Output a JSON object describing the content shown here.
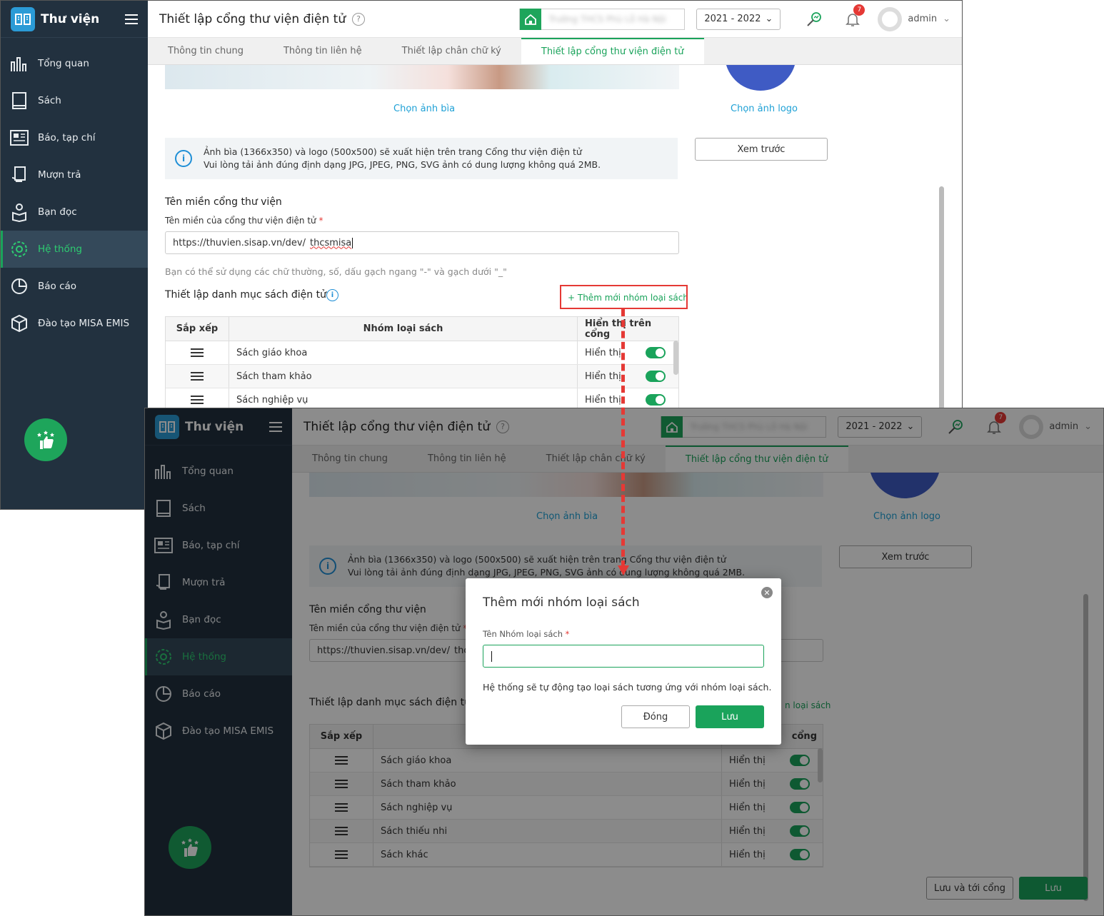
{
  "app": {
    "brand": "Thư viện",
    "page_title": "Thiết lập cổng thư viện điện tử",
    "school_year": "2021 - 2022",
    "notification_count": "7",
    "user_name": "admin",
    "school_name": "Trường THCS Phù Lỗ Hà Nội"
  },
  "sidebar": {
    "items": [
      {
        "label": "Tổng quan",
        "icon": "chart-icon"
      },
      {
        "label": "Sách",
        "icon": "book-icon"
      },
      {
        "label": "Báo, tạp chí",
        "icon": "newspaper-icon"
      },
      {
        "label": "Mượn trả",
        "icon": "borrow-icon"
      },
      {
        "label": "Bạn đọc",
        "icon": "reader-icon"
      },
      {
        "label": "Hệ thống",
        "icon": "gear-icon",
        "active": true
      },
      {
        "label": "Báo cáo",
        "icon": "pie-icon"
      },
      {
        "label": "Đào tạo MISA EMIS",
        "icon": "cube-icon"
      }
    ]
  },
  "tabs": [
    "Thông tin chung",
    "Thông tin liên hệ",
    "Thiết lập chân chữ ký",
    "Thiết lập cổng thư viện điện tử"
  ],
  "images": {
    "choose_cover": "Chọn ảnh bìa",
    "choose_logo": "Chọn ảnh logo",
    "preview": "Xem trước"
  },
  "info": {
    "line1": "Ảnh bìa (1366x350) và logo (500x500) sẽ xuất hiện trên trang Cổng thư viện điện tử",
    "line2": "Vui lòng tải ảnh đúng định dạng JPG, JPEG, PNG, SVG ảnh có dung lượng không quá 2MB."
  },
  "domain": {
    "section_title": "Tên miền cổng thư viện",
    "label": "Tên miền của cổng thư viện điện tử",
    "prefix": "https://thuvien.sisap.vn/dev/",
    "value": "thcsmisa",
    "value_truncated": "thcsm",
    "hint": "Bạn có thể sử dụng các chữ thường, số, dấu gạch ngang \"-\" và gạch dưới \"_\""
  },
  "catalog": {
    "section_title": "Thiết lập danh mục sách điện tử",
    "add_link": "+ Thêm mới nhóm loại sách",
    "add_link_partial": "n loại sách",
    "columns": [
      "Sắp xếp",
      "Nhóm loại sách",
      "Hiển thị trên cổng"
    ],
    "column3_partial": "cổng",
    "display_label": "Hiển thị",
    "rows": [
      "Sách giáo khoa",
      "Sách tham khảo",
      "Sách nghiệp vụ",
      "Sách thiếu nhi",
      "Sách khác"
    ]
  },
  "footer": {
    "save_and_go": "Lưu và tới cổng",
    "save": "Lưu"
  },
  "modal": {
    "title": "Thêm mới nhóm loại sách",
    "label": "Tên Nhóm loại sách",
    "input_value": "",
    "note": "Hệ thống sẽ tự động tạo loại sách tương ứng với nhóm loại sách.",
    "close_label": "Đóng",
    "save_label": "Lưu"
  },
  "colors": {
    "sidebar_bg": "#22313f",
    "accent_green": "#1aa35b",
    "link_blue": "#1fa1d6",
    "highlight_red": "#e53935"
  }
}
